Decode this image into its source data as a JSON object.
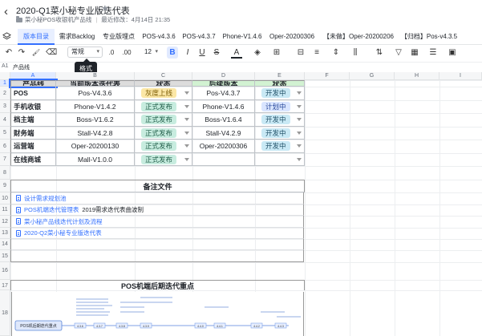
{
  "header": {
    "back": "‹",
    "title": "2020-Q1菜小秘专业版迭代表",
    "star": "★",
    "folder": "菜小秘POS收银机产品线",
    "last_modified": "最近修改：4月14日 21:35"
  },
  "tabs": [
    {
      "label": "版本目录",
      "active": true
    },
    {
      "label": "需求Backlog"
    },
    {
      "label": "专业版埋点"
    },
    {
      "label": "POS-v4.3.6"
    },
    {
      "label": "POS-v4.3.7"
    },
    {
      "label": "Phone-V1.4.6"
    },
    {
      "label": "Oper-20200306"
    },
    {
      "label": "【未做】Oper-20200206"
    },
    {
      "label": "【归档】Pos-v4.3.5"
    }
  ],
  "toolbar": {
    "undo": "↶",
    "redo": "↷",
    "format_painter": "🖌",
    "clear": "⌫",
    "number_format": "常规",
    "dec_less": ".0",
    "dec_more": ".00",
    "font_size": "12",
    "bold": "B",
    "italic": "I",
    "underline": "U",
    "strike": "S",
    "font_color": "A",
    "fill": "◈",
    "border": "⊞",
    "merge": "⊟",
    "halign": "≡",
    "valign": "⇕",
    "insert_col": "⫼",
    "sort": "⇅",
    "filter": "▽",
    "freeze": "▦",
    "wrap": "☰",
    "image": "▣",
    "tooltip": "格式"
  },
  "formula_bar": {
    "cell": "A1",
    "value": "产品线"
  },
  "columns": [
    "A",
    "B",
    "C",
    "D",
    "E",
    "F",
    "G",
    "H",
    "I"
  ],
  "rows": [
    "1",
    "2",
    "3",
    "4",
    "5",
    "6",
    "7",
    "8",
    "9",
    "10",
    "11",
    "12",
    "13",
    "14",
    "15",
    "16",
    "17",
    "18"
  ],
  "table": {
    "headers": [
      "产品线",
      "当前版本迭代表",
      "状态",
      "后续版本",
      "状态"
    ],
    "rows": [
      {
        "product": "POS",
        "current": "Pos-V4.3.6",
        "status": "灰度上线",
        "next": "Pos-V4.3.7",
        "next_status": "开发中"
      },
      {
        "product": "手机收银",
        "current": "Phone-V1.4.2",
        "status": "正式发布",
        "next": "Phone-V1.4.6",
        "next_status": "计划中"
      },
      {
        "product": "档主端",
        "current": "Boss-V1.6.2",
        "status": "正式发布",
        "next": "Boss-V1.6.4",
        "next_status": "开发中"
      },
      {
        "product": "财务端",
        "current": "Stall-V4.2.8",
        "status": "正式发布",
        "next": "Stall-V4.2.9",
        "next_status": "开发中"
      },
      {
        "product": "运营端",
        "current": "Oper-20200130",
        "status": "正式发布",
        "next": "Oper-20200306",
        "next_status": "开发中"
      },
      {
        "product": "在线商城",
        "current": "Mall-V1.0.0",
        "status": "正式发布",
        "next": "",
        "next_status": ""
      }
    ]
  },
  "status_colors": {
    "灰度上线": {
      "bg": "#fbe7a6",
      "fg": "#7a5a00"
    },
    "正式发布": {
      "bg": "#c7ecdf",
      "fg": "#1f5c47"
    },
    "开发中": {
      "bg": "#c9e9f5",
      "fg": "#1f4f66"
    },
    "计划中": {
      "bg": "#d9e5ff",
      "fg": "#2b4a9a"
    }
  },
  "header_colors": {
    "left": "#dcdcdc",
    "right": "#d2f2d2"
  },
  "notes": {
    "title": "备注文件",
    "items": [
      {
        "link": "设计需求规划池",
        "text": ""
      },
      {
        "link": "POS机端迭代管理表",
        "text": "2019需求迭代表曲波制"
      },
      {
        "link": "菜小秘产品线迭代计划及流程",
        "text": ""
      },
      {
        "link": "2020-Q2菜小秘专业版迭代表",
        "text": ""
      }
    ]
  },
  "image_title": "POS机端后期迭代重点",
  "diagram": {
    "root": "POS机后期迭代重点",
    "nodes": [
      "4.3.6",
      "4.3.7",
      "4.3.8",
      "4.3.9",
      "4.4.0",
      "4.4.1",
      "4.4.2",
      "4.4.3"
    ]
  }
}
